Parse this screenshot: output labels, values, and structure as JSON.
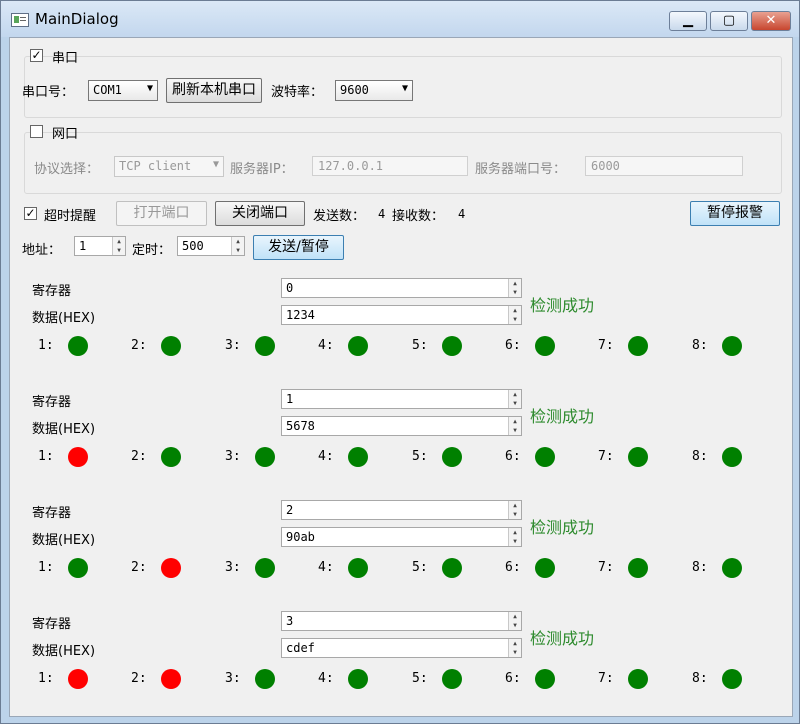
{
  "window": {
    "title": "MainDialog",
    "minimize": "▁",
    "maximize": "▢",
    "close": "✕"
  },
  "serial": {
    "group_label": "串口",
    "port_label": "串口号：",
    "port_value": "COM1",
    "refresh_button": "刷新本机串口",
    "baud_label": "波特率：",
    "baud_value": "9600"
  },
  "network": {
    "group_label": "网口",
    "protocol_label": "协议选择：",
    "protocol_value": "TCP client",
    "server_ip_label": "服务器IP：",
    "server_ip_value": "127.0.0.1",
    "server_port_label": "服务器端口号：",
    "server_port_value": "6000"
  },
  "controls": {
    "timeout_label": "超时提醒",
    "open_port": "打开端口",
    "close_port": "关闭端口",
    "sent_label": "发送数：",
    "sent_count": "4",
    "recv_label": "接收数：",
    "recv_count": "4",
    "pause_alarm": "暂停报警",
    "address_label": "地址：",
    "address_value": "1",
    "timer_label": "定时：",
    "timer_value": "500",
    "send_pause": "发送/暂停"
  },
  "colors": {
    "green": "#008000",
    "red": "#ff0000"
  },
  "blocks": [
    {
      "register_label": "寄存器",
      "register_value": "0",
      "data_label": "数据(HEX)",
      "data_value": "1234",
      "status": "检测成功",
      "leds": [
        {
          "label": "1:",
          "state": "green"
        },
        {
          "label": "2:",
          "state": "green"
        },
        {
          "label": "3:",
          "state": "green"
        },
        {
          "label": "4:",
          "state": "green"
        },
        {
          "label": "5:",
          "state": "green"
        },
        {
          "label": "6:",
          "state": "green"
        },
        {
          "label": "7:",
          "state": "green"
        },
        {
          "label": "8:",
          "state": "green"
        }
      ]
    },
    {
      "register_label": "寄存器",
      "register_value": "1",
      "data_label": "数据(HEX)",
      "data_value": "5678",
      "status": "检测成功",
      "leds": [
        {
          "label": "1:",
          "state": "red"
        },
        {
          "label": "2:",
          "state": "green"
        },
        {
          "label": "3:",
          "state": "green"
        },
        {
          "label": "4:",
          "state": "green"
        },
        {
          "label": "5:",
          "state": "green"
        },
        {
          "label": "6:",
          "state": "green"
        },
        {
          "label": "7:",
          "state": "green"
        },
        {
          "label": "8:",
          "state": "green"
        }
      ]
    },
    {
      "register_label": "寄存器",
      "register_value": "2",
      "data_label": "数据(HEX)",
      "data_value": "90ab",
      "status": "检测成功",
      "leds": [
        {
          "label": "1:",
          "state": "green"
        },
        {
          "label": "2:",
          "state": "red"
        },
        {
          "label": "3:",
          "state": "green"
        },
        {
          "label": "4:",
          "state": "green"
        },
        {
          "label": "5:",
          "state": "green"
        },
        {
          "label": "6:",
          "state": "green"
        },
        {
          "label": "7:",
          "state": "green"
        },
        {
          "label": "8:",
          "state": "green"
        }
      ]
    },
    {
      "register_label": "寄存器",
      "register_value": "3",
      "data_label": "数据(HEX)",
      "data_value": "cdef",
      "status": "检测成功",
      "leds": [
        {
          "label": "1:",
          "state": "red"
        },
        {
          "label": "2:",
          "state": "red"
        },
        {
          "label": "3:",
          "state": "green"
        },
        {
          "label": "4:",
          "state": "green"
        },
        {
          "label": "5:",
          "state": "green"
        },
        {
          "label": "6:",
          "state": "green"
        },
        {
          "label": "7:",
          "state": "green"
        },
        {
          "label": "8:",
          "state": "green"
        }
      ]
    }
  ]
}
